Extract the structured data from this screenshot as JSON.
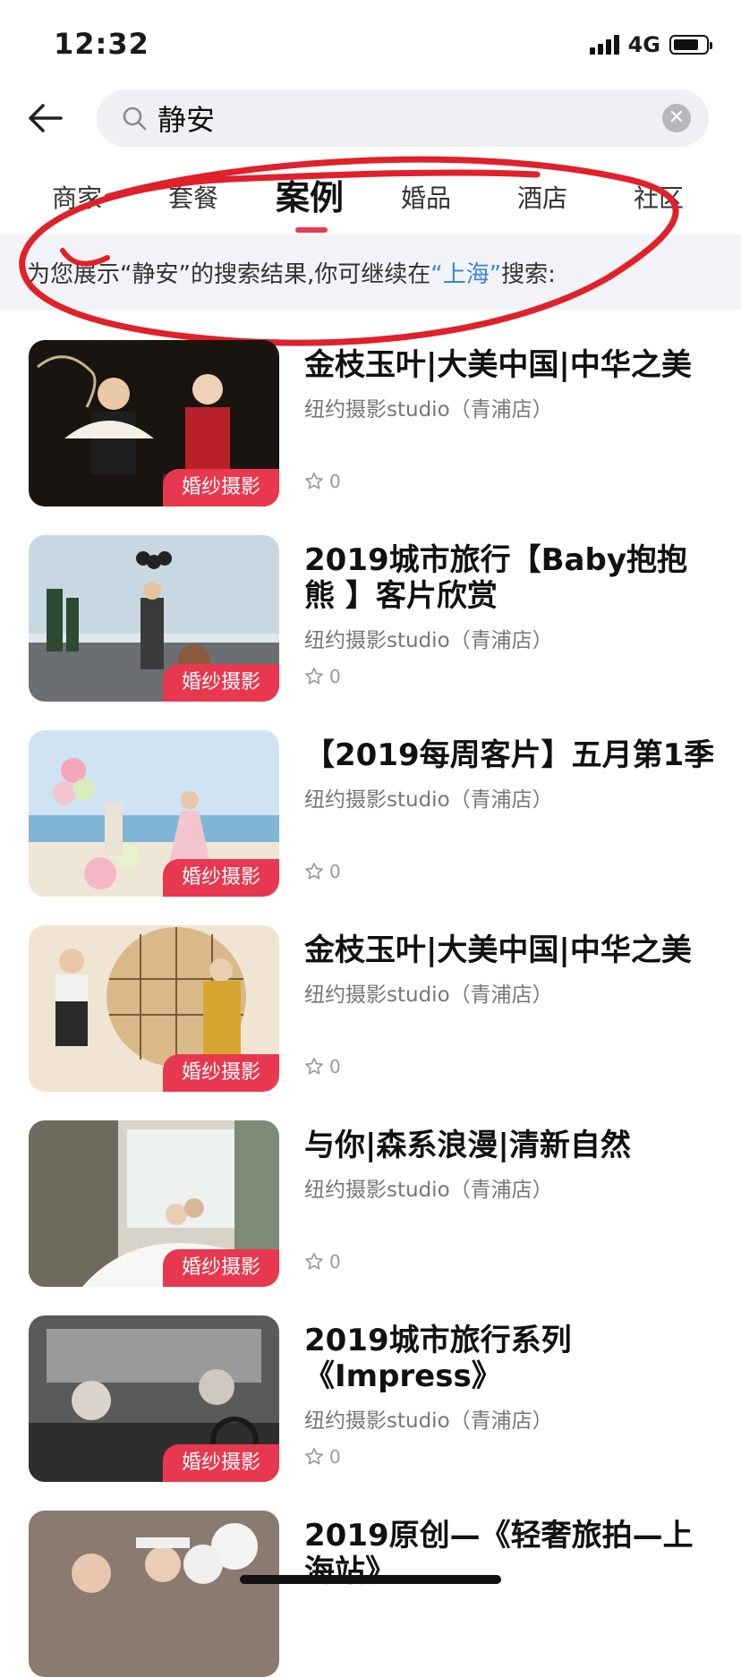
{
  "status_bar": {
    "time": "12:32",
    "network": "4G",
    "battery_level": 0.8
  },
  "search": {
    "query": "静安"
  },
  "tabs": [
    {
      "label": "商家"
    },
    {
      "label": "套餐"
    },
    {
      "label": "案例",
      "active": true
    },
    {
      "label": "婚品"
    },
    {
      "label": "酒店"
    },
    {
      "label": "社区"
    }
  ],
  "notice": {
    "prefix": "为您展示“静安”的搜索结果,你可继续在",
    "city": "“上海”",
    "suffix": "搜索:"
  },
  "items": [
    {
      "title": "金枝玉叶|大美中国|中华之美",
      "shop": "纽约摄影studio（青浦店）",
      "badge": "婚纱摄影",
      "likes": "0"
    },
    {
      "title": "2019城市旅行【Baby抱抱熊 】客片欣赏",
      "shop": "纽约摄影studio（青浦店）",
      "badge": "婚纱摄影",
      "likes": "0"
    },
    {
      "title": "【2019每周客片】五月第1季",
      "shop": "纽约摄影studio（青浦店）",
      "badge": "婚纱摄影",
      "likes": "0"
    },
    {
      "title": "金枝玉叶|大美中国|中华之美",
      "shop": "纽约摄影studio（青浦店）",
      "badge": "婚纱摄影",
      "likes": "0"
    },
    {
      "title": "与你|森系浪漫|清新自然",
      "shop": "纽约摄影studio（青浦店）",
      "badge": "婚纱摄影",
      "likes": "0"
    },
    {
      "title": "2019城市旅行系列《Impress》",
      "shop": "纽约摄影studio（青浦店）",
      "badge": "婚纱摄影",
      "likes": "0"
    },
    {
      "title": "2019原创—《轻奢旅拍—上海站》"
    }
  ],
  "colors": {
    "accent": "#e8384f",
    "link": "#3a86d8"
  }
}
